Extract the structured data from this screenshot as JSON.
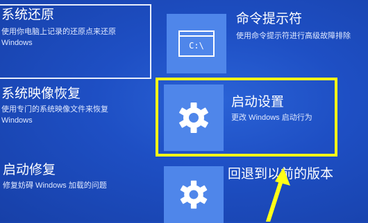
{
  "options": {
    "system_restore": {
      "title": "系统还原",
      "desc_line1": "使用你电脑上记录的还原点来还原",
      "desc_line2": "Windows"
    },
    "command_prompt": {
      "title": "命令提示符",
      "desc": "使用命令提示符进行高级故障排除",
      "icon_text": "C:\\"
    },
    "system_image": {
      "title": "系统映像恢复",
      "desc_line1": "使用专门的系统映像文件来恢复",
      "desc_line2": "Windows"
    },
    "startup_settings": {
      "title": "启动设置",
      "desc": "更改 Windows 启动行为"
    },
    "startup_repair": {
      "title": "启动修复",
      "desc": "修复妨碍 Windows 加载的问题"
    },
    "go_back": {
      "title": "回退到以前的版本"
    }
  },
  "colors": {
    "highlight": "#ffff17",
    "tile": "#4f86ea",
    "background": "#1e4fc4"
  },
  "icons": {
    "command_prompt": "terminal-icon",
    "startup_settings": "gear-icon",
    "go_back": "gear-icon"
  }
}
